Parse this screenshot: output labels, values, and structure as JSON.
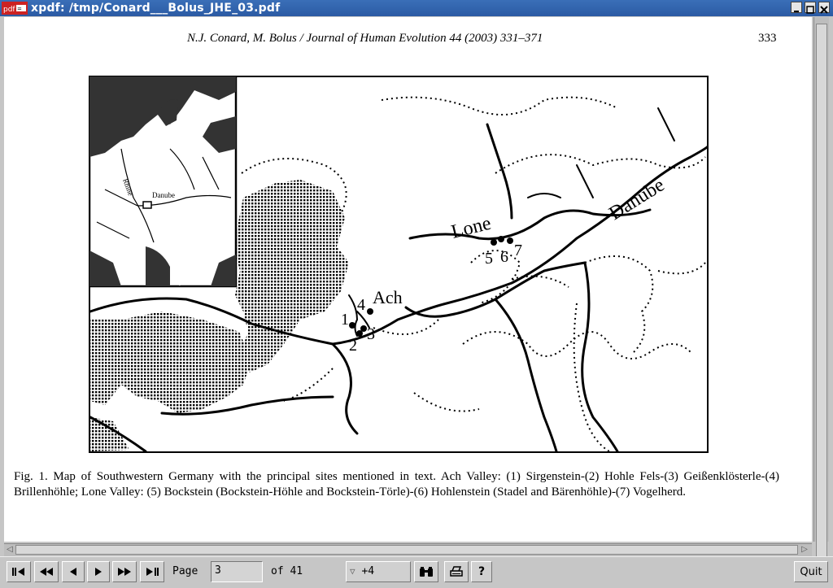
{
  "window": {
    "title": "xpdf: /tmp/Conard___Bolus_JHE_03.pdf"
  },
  "page": {
    "header": "N.J. Conard, M. Bolus / Journal of Human Evolution 44 (2003) 331–371",
    "header_authors": "N.J. Conard, M. Bolus",
    "header_journal": "Journal of Human Evolution",
    "header_ref": "44 (2003) 331–371",
    "number": "333",
    "map_labels": {
      "rhine": "Rhine",
      "danube_inset": "Danube",
      "danube": "Danube",
      "lone": "Lone",
      "ach": "Ach",
      "s1": "1",
      "s2": "2",
      "s3": "3",
      "s4": "4",
      "s5": "5",
      "s6": "6",
      "s7": "7"
    },
    "caption": "Fig. 1. Map of Southwestern Germany with the principal sites mentioned in text. Ach Valley: (1) Sirgenstein-(2) Hohle Fels-(3) Geißenklösterle-(4) Brillenhöhle; Lone Valley: (5) Bockstein (Bockstein-Höhle and Bockstein-Törle)-(6) Hohlenstein (Stadel and Bärenhöhle)-(7) Vogelherd."
  },
  "toolbar": {
    "page_label": "Page",
    "page_value": "3",
    "of_label": "of 41",
    "zoom_value": "+4",
    "quit_label": "Quit"
  },
  "icons": [
    "first-page-icon",
    "prev-page-icon",
    "prev-icon",
    "next-icon",
    "next-page-icon",
    "last-page-icon",
    "find-icon",
    "print-icon",
    "help-icon"
  ]
}
